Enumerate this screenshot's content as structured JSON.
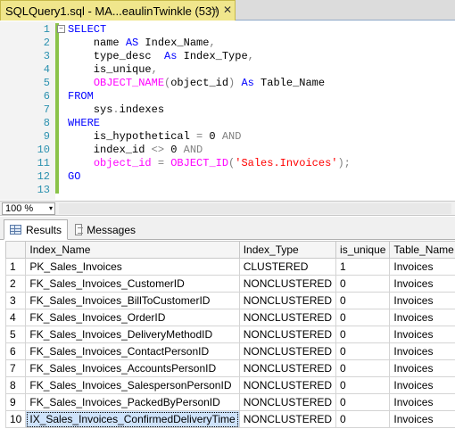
{
  "tab": {
    "title": "SQLQuery1.sql - MA...eaulinTwinkle (53))",
    "pin_glyph": "⊣",
    "close_glyph": "✕"
  },
  "editor": {
    "lines": [
      {
        "n": "1",
        "tokens": [
          {
            "t": "SELECT",
            "c": "kw"
          }
        ]
      },
      {
        "n": "2",
        "tokens": [
          {
            "t": "    name ",
            "c": "txt"
          },
          {
            "t": "AS",
            "c": "kw"
          },
          {
            "t": " Index_Name",
            "c": "txt"
          },
          {
            "t": ",",
            "c": "op"
          }
        ]
      },
      {
        "n": "3",
        "tokens": [
          {
            "t": "    type_desc  ",
            "c": "txt"
          },
          {
            "t": "As",
            "c": "kw"
          },
          {
            "t": " Index_Type",
            "c": "txt"
          },
          {
            "t": ",",
            "c": "op"
          }
        ]
      },
      {
        "n": "4",
        "tokens": [
          {
            "t": "    is_unique",
            "c": "txt"
          },
          {
            "t": ",",
            "c": "op"
          }
        ]
      },
      {
        "n": "5",
        "tokens": [
          {
            "t": "    ",
            "c": "txt"
          },
          {
            "t": "OBJECT_NAME",
            "c": "fn"
          },
          {
            "t": "(",
            "c": "op"
          },
          {
            "t": "object_id",
            "c": "txt"
          },
          {
            "t": ")",
            "c": "op"
          },
          {
            "t": " ",
            "c": "txt"
          },
          {
            "t": "As",
            "c": "kw"
          },
          {
            "t": " Table_Name",
            "c": "txt"
          }
        ]
      },
      {
        "n": "6",
        "tokens": [
          {
            "t": "FROM",
            "c": "kw"
          }
        ]
      },
      {
        "n": "7",
        "tokens": [
          {
            "t": "    sys",
            "c": "txt"
          },
          {
            "t": ".",
            "c": "op"
          },
          {
            "t": "indexes",
            "c": "txt"
          }
        ]
      },
      {
        "n": "8",
        "tokens": [
          {
            "t": "WHERE",
            "c": "kw"
          }
        ]
      },
      {
        "n": "9",
        "tokens": [
          {
            "t": "    is_hypothetical ",
            "c": "txt"
          },
          {
            "t": "=",
            "c": "op"
          },
          {
            "t": " 0 ",
            "c": "txt"
          },
          {
            "t": "AND",
            "c": "op"
          }
        ]
      },
      {
        "n": "10",
        "tokens": [
          {
            "t": "    index_id ",
            "c": "txt"
          },
          {
            "t": "<>",
            "c": "op"
          },
          {
            "t": " 0 ",
            "c": "txt"
          },
          {
            "t": "AND",
            "c": "op"
          }
        ]
      },
      {
        "n": "11",
        "tokens": [
          {
            "t": "    ",
            "c": "txt"
          },
          {
            "t": "object_id",
            "c": "fn"
          },
          {
            "t": " ",
            "c": "txt"
          },
          {
            "t": "=",
            "c": "op"
          },
          {
            "t": " ",
            "c": "txt"
          },
          {
            "t": "OBJECT_ID",
            "c": "fn"
          },
          {
            "t": "(",
            "c": "op"
          },
          {
            "t": "'Sales.Invoices'",
            "c": "str"
          },
          {
            "t": ");",
            "c": "op"
          }
        ]
      },
      {
        "n": "12",
        "tokens": [
          {
            "t": "GO",
            "c": "kw"
          }
        ]
      },
      {
        "n": "13",
        "tokens": []
      }
    ],
    "fold_glyph": "−"
  },
  "zoom": {
    "value": "100 %",
    "arrow": "▾"
  },
  "results_tabs": {
    "results_label": "Results",
    "messages_label": "Messages"
  },
  "grid": {
    "columns": [
      "Index_Name",
      "Index_Type",
      "is_unique",
      "Table_Name"
    ],
    "rows": [
      [
        "1",
        "PK_Sales_Invoices",
        "CLUSTERED",
        "1",
        "Invoices"
      ],
      [
        "2",
        "FK_Sales_Invoices_CustomerID",
        "NONCLUSTERED",
        "0",
        "Invoices"
      ],
      [
        "3",
        "FK_Sales_Invoices_BillToCustomerID",
        "NONCLUSTERED",
        "0",
        "Invoices"
      ],
      [
        "4",
        "FK_Sales_Invoices_OrderID",
        "NONCLUSTERED",
        "0",
        "Invoices"
      ],
      [
        "5",
        "FK_Sales_Invoices_DeliveryMethodID",
        "NONCLUSTERED",
        "0",
        "Invoices"
      ],
      [
        "6",
        "FK_Sales_Invoices_ContactPersonID",
        "NONCLUSTERED",
        "0",
        "Invoices"
      ],
      [
        "7",
        "FK_Sales_Invoices_AccountsPersonID",
        "NONCLUSTERED",
        "0",
        "Invoices"
      ],
      [
        "8",
        "FK_Sales_Invoices_SalespersonPersonID",
        "NONCLUSTERED",
        "0",
        "Invoices"
      ],
      [
        "9",
        "FK_Sales_Invoices_PackedByPersonID",
        "NONCLUSTERED",
        "0",
        "Invoices"
      ],
      [
        "10",
        "IX_Sales_Invoices_ConfirmedDeliveryTime",
        "NONCLUSTERED",
        "0",
        "Invoices"
      ]
    ],
    "selected_row": 10
  },
  "colors": {
    "keyword": "#0000ff",
    "function": "#ff00ff",
    "string": "#ff0000",
    "operator": "#808080",
    "line_number": "#2b91af",
    "tab_active": "#f0e68c",
    "change_bar": "#8bc34a"
  }
}
